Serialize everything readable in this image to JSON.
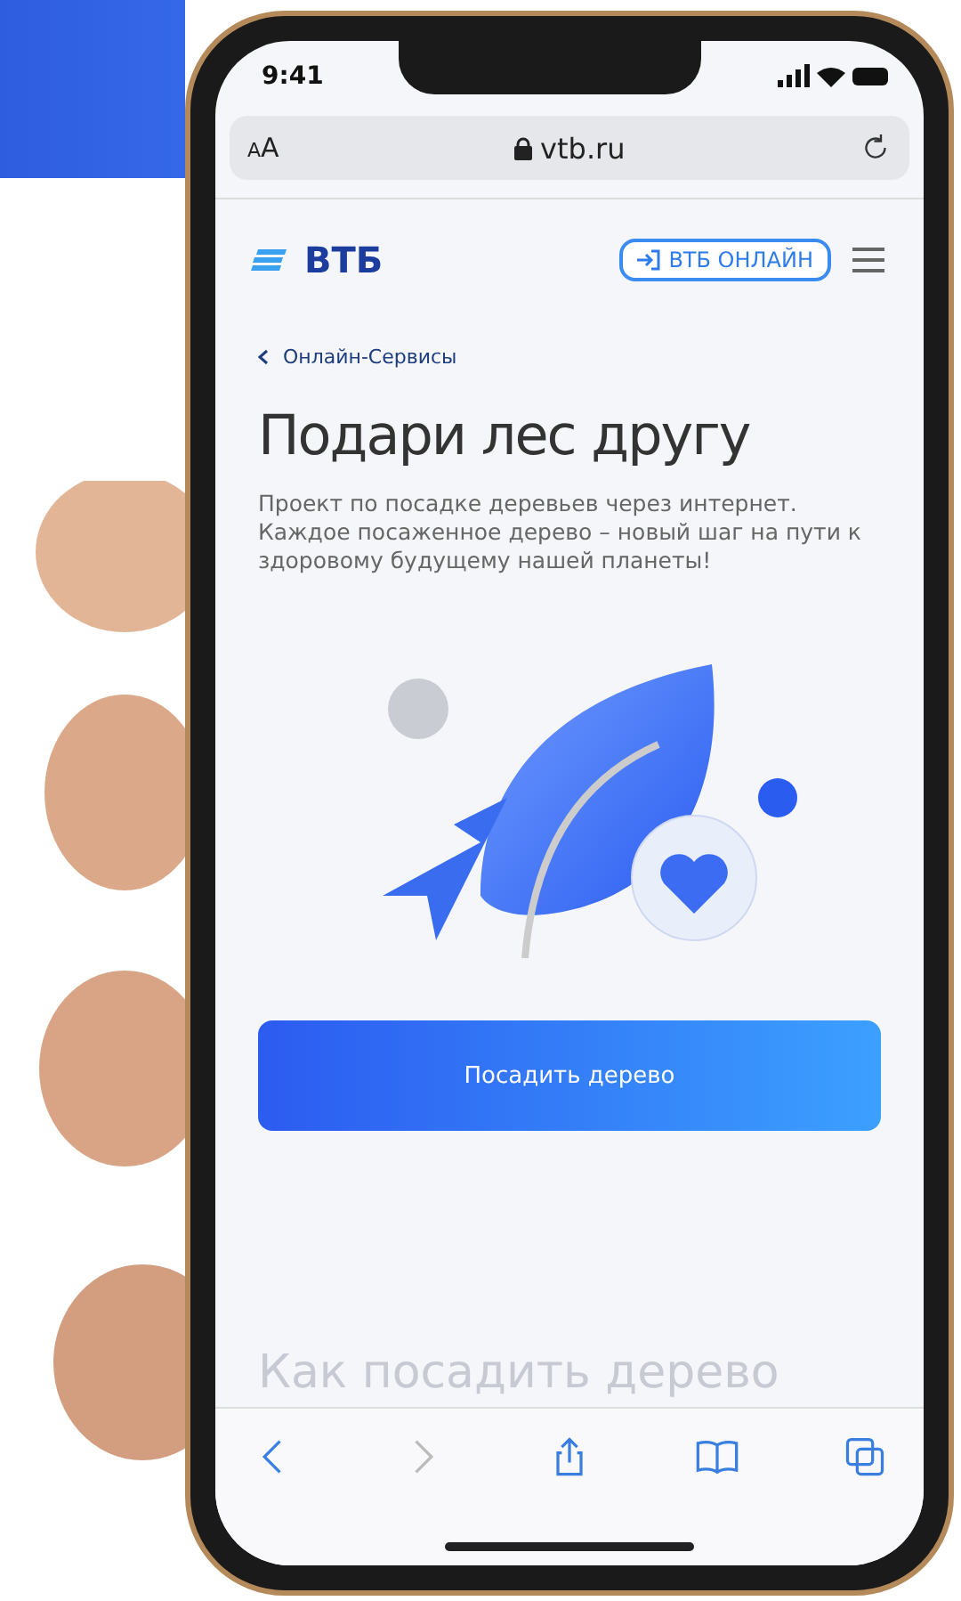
{
  "status_bar": {
    "time": "9:41"
  },
  "address_bar": {
    "text_size": "AA",
    "url": "vtb.ru"
  },
  "header": {
    "logo": "ВТБ",
    "login_button": "ВТБ ОНЛАЙН"
  },
  "breadcrumb": "Онлайн-Сервисы",
  "title": "Подари лес другу",
  "description": "Проект по посадке деревьев через интернет. Каждое посаженное дерево – новый шаг на пути к здоровому будущему нашей планеты!",
  "cta_button": "Посадить дерево",
  "next_heading": "Как посадить дерево",
  "toolbar": [
    {
      "kind": "back",
      "disabled": false
    },
    {
      "kind": "forward",
      "disabled": true
    },
    {
      "kind": "share",
      "disabled": false
    },
    {
      "kind": "bookmarks",
      "disabled": false
    },
    {
      "kind": "tabs",
      "disabled": false
    }
  ]
}
